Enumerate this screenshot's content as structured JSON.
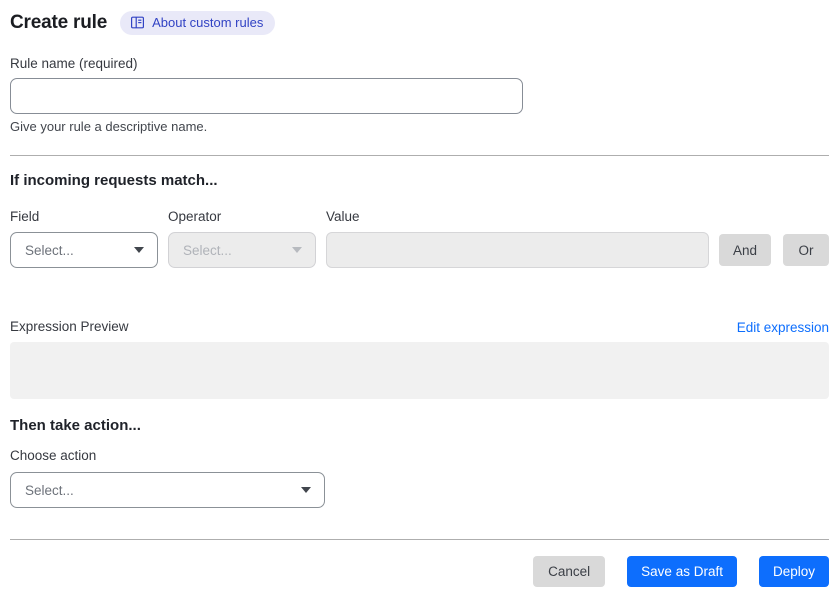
{
  "header": {
    "title": "Create rule",
    "about_badge": {
      "label": "About custom rules",
      "icon": "book-icon"
    }
  },
  "rule_name": {
    "label": "Rule name (required)",
    "value": "",
    "helper_text": "Give your rule a descriptive name."
  },
  "match": {
    "heading": "If incoming requests match...",
    "field_label": "Field",
    "operator_label": "Operator",
    "value_label": "Value",
    "field_placeholder": "Select...",
    "operator_placeholder": "Select...",
    "value_text": "",
    "and_label": "And",
    "or_label": "Or"
  },
  "expression": {
    "label": "Expression Preview",
    "edit_link": "Edit expression",
    "preview_text": ""
  },
  "action": {
    "heading": "Then take action...",
    "label": "Choose action",
    "placeholder": "Select..."
  },
  "footer": {
    "cancel_label": "Cancel",
    "save_draft_label": "Save as Draft",
    "deploy_label": "Deploy"
  },
  "colors": {
    "primary_blue": "#0d6efd",
    "link_blue": "#0d6efd",
    "badge_bg": "#e9e9f8",
    "badge_text": "#3243c4",
    "disabled_bg": "#ececec",
    "neutral_button_bg": "#d9d9d9",
    "preview_bg": "#f1f1f1"
  }
}
